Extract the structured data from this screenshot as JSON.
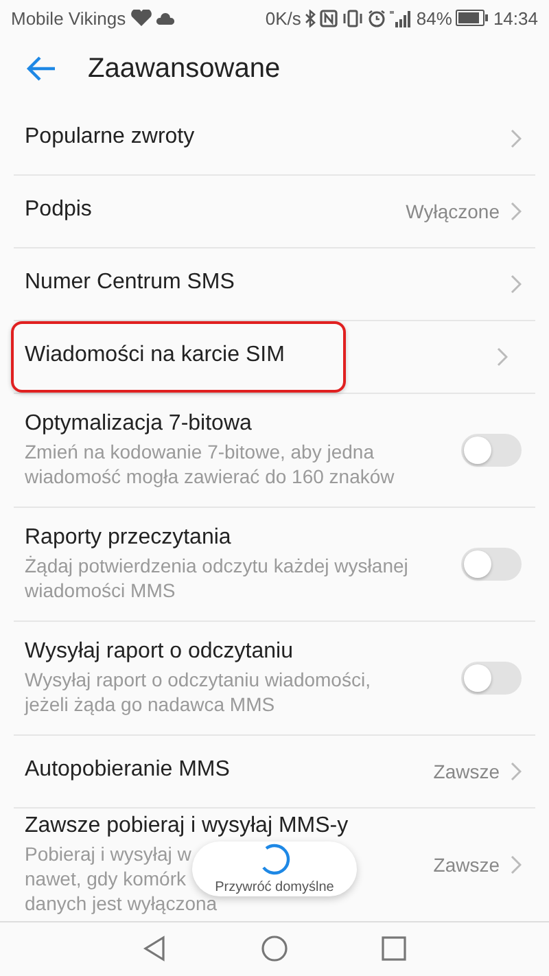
{
  "status_bar": {
    "carrier": "Mobile Vikings",
    "speed": "0K/s",
    "battery": "84%",
    "time": "14:34"
  },
  "header": {
    "title": "Zaawansowane"
  },
  "items": [
    {
      "kind": "link",
      "title": "Popularne zwroty",
      "highlighted": false
    },
    {
      "kind": "link",
      "title": "Podpis",
      "value": "Wyłączone",
      "highlighted": false
    },
    {
      "kind": "link",
      "title": "Numer Centrum SMS",
      "highlighted": false
    },
    {
      "kind": "link",
      "title": "Wiadomości na karcie SIM",
      "highlighted": true
    },
    {
      "kind": "toggle",
      "title": "Optymalizacja 7-bitowa",
      "subtitle": [
        "Zmień na kodowanie 7-bitowe, aby jedna",
        "wiadomość mogła zawierać do 160 znaków"
      ],
      "on": false,
      "highlighted": false
    },
    {
      "kind": "toggle",
      "title": "Raporty przeczytania",
      "subtitle": [
        "Żądaj potwierdzenia odczytu każdej wysłanej",
        "wiadomości MMS"
      ],
      "on": false,
      "highlighted": false
    },
    {
      "kind": "toggle",
      "title": "Wysyłaj raport o odczytaniu",
      "subtitle": [
        "Wysyłaj raport o odczytaniu wiadomości,",
        "jeżeli żąda go nadawca MMS"
      ],
      "on": false,
      "highlighted": false
    },
    {
      "kind": "link",
      "title": "Autopobieranie MMS",
      "value": "Zawsze",
      "highlighted": false
    },
    {
      "kind": "link",
      "title": "Zawsze pobieraj i wysyłaj MMS-y",
      "subtitle": [
        "Pobieraj i wysyłaj w",
        "nawet, gdy komórk",
        "danych jest wyłączona"
      ],
      "value": "Zawsze",
      "highlighted": false
    }
  ],
  "toast": {
    "label": "Przywróć domyślne"
  }
}
